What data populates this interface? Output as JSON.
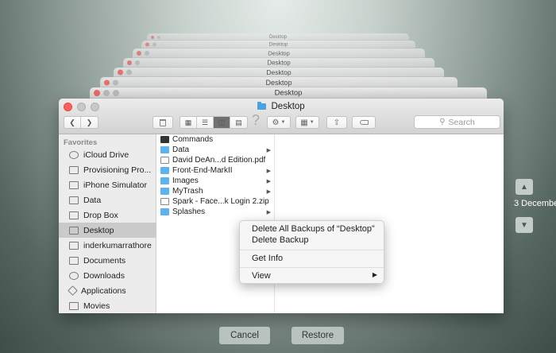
{
  "window": {
    "title": "Desktop",
    "search_placeholder": "Search"
  },
  "stack_titles": [
    "Desktop",
    "Desktop",
    "Desktop",
    "Desktop",
    "Desktop",
    "Desktop",
    "Desktop",
    "Desktop"
  ],
  "sidebar": {
    "heading": "Favorites",
    "items": [
      {
        "label": "iCloud Drive",
        "icon": "cloud-icon"
      },
      {
        "label": "Provisioning Pro...",
        "icon": "folder-icon"
      },
      {
        "label": "iPhone Simulator",
        "icon": "folder-icon"
      },
      {
        "label": "Data",
        "icon": "folder-icon"
      },
      {
        "label": "Drop Box",
        "icon": "folder-icon"
      },
      {
        "label": "Desktop",
        "icon": "desktop-icon"
      },
      {
        "label": "inderkumarrathore",
        "icon": "home-icon"
      },
      {
        "label": "Documents",
        "icon": "documents-icon"
      },
      {
        "label": "Downloads",
        "icon": "downloads-icon"
      },
      {
        "label": "Applications",
        "icon": "applications-icon"
      },
      {
        "label": "Movies",
        "icon": "movies-icon"
      }
    ]
  },
  "files": [
    {
      "name": "Commands",
      "type": "cmd",
      "has_children": false
    },
    {
      "name": "Data",
      "type": "folder",
      "has_children": true
    },
    {
      "name": "David DeAn...d Edition.pdf",
      "type": "doc",
      "has_children": false
    },
    {
      "name": "Front-End-MarkII",
      "type": "folder",
      "has_children": true
    },
    {
      "name": "Images",
      "type": "folder",
      "has_children": true
    },
    {
      "name": "MyTrash",
      "type": "folder",
      "has_children": true
    },
    {
      "name": "Spark - Face...k Login 2.zip",
      "type": "doc",
      "has_children": false
    },
    {
      "name": "Splashes",
      "type": "folder",
      "has_children": true
    }
  ],
  "context_menu": {
    "delete_all": "Delete All Backups of “Desktop”",
    "delete_backup": "Delete Backup",
    "get_info": "Get Info",
    "view": "View"
  },
  "timeline": {
    "date_label": "3 Decembe"
  },
  "buttons": {
    "cancel": "Cancel",
    "restore": "Restore"
  }
}
